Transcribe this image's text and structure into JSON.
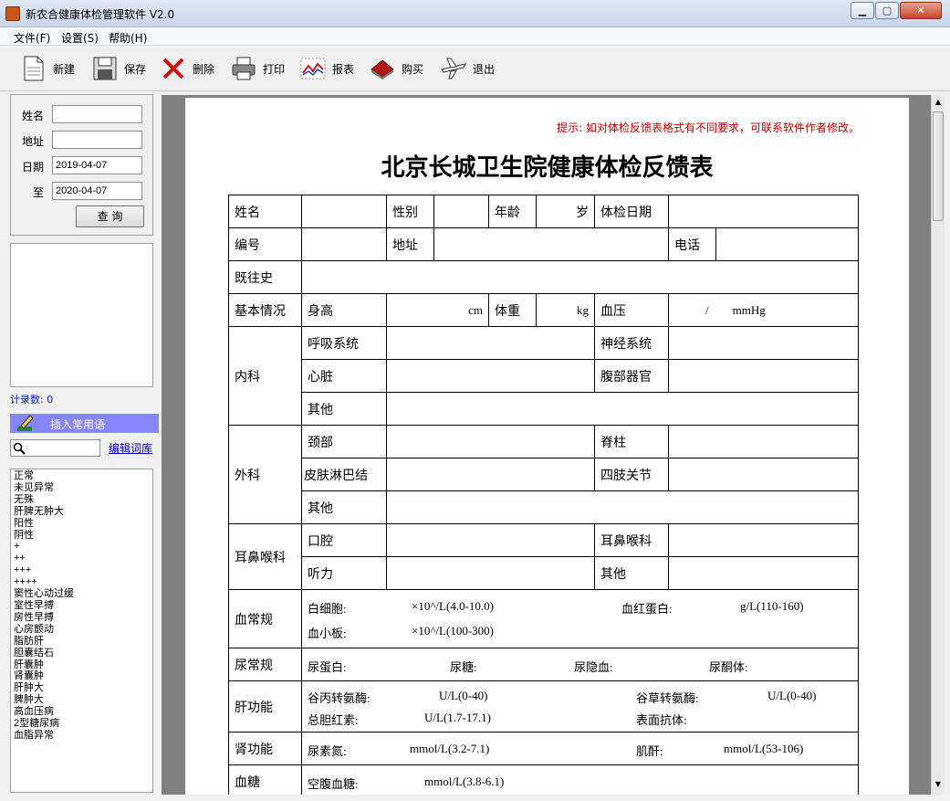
{
  "window": {
    "title": "新农合健康体检管理软件 V2.0"
  },
  "menu": [
    "文件(F)",
    "设置(S)",
    "帮助(H)"
  ],
  "toolbar": {
    "new": "新建",
    "save": "保存",
    "delete": "删除",
    "print": "打印",
    "report": "报表",
    "buy": "购买",
    "exit": "退出"
  },
  "search": {
    "name_label": "姓名",
    "address_label": "地址",
    "date_label": "日期",
    "to_label": "至",
    "date_from": "2019-04-07",
    "date_to": "2020-04-07",
    "query_button": "查 询"
  },
  "records": {
    "count_label": "计录数: 0"
  },
  "phrases": {
    "insert_label": "插入常用语",
    "edit_link": "编辑词库",
    "items": [
      "正常",
      "未见异常",
      "无殊",
      "肝脾无肿大",
      "阳性",
      "阴性",
      "+",
      "++",
      "+++",
      "++++",
      "窦性心动过缓",
      "室性早搏",
      "房性早搏",
      "心房颤动",
      "脂肪肝",
      "胆囊结石",
      "肝囊肿",
      "肾囊肿",
      "肝肿大",
      "脾肿大",
      "高血压病",
      "2型糖尿病",
      "血脂异常"
    ]
  },
  "document": {
    "hint": "提示: 如对体检反馈表格式有不同要求，可联系软件作者修改。",
    "title": "北京长城卫生院健康体检反馈表",
    "rows": {
      "name": "姓名",
      "gender": "性别",
      "age": "年龄",
      "age_unit": "岁",
      "exam_date": "体检日期",
      "id": "编号",
      "address": "地址",
      "phone": "电话",
      "history": "既往史",
      "basic": "基本情况",
      "height": "身高",
      "height_unit": "cm",
      "weight": "体重",
      "weight_unit": "kg",
      "bp": "血压",
      "bp_unit": "/        mmHg",
      "internal": "内科",
      "respiratory": "呼吸系统",
      "nervous": "神经系统",
      "heart": "心脏",
      "abdomen": "腹部器官",
      "other": "其他",
      "surgery": "外科",
      "neck": "颈部",
      "spine": "脊柱",
      "skin_lymph": "皮肤淋巴结",
      "limbs": "四肢关节",
      "ent": "耳鼻喉科",
      "mouth": "口腔",
      "ent2": "耳鼻喉科",
      "hearing": "听力",
      "blood": "血常规",
      "wbc": "白细胞:",
      "wbc_unit": "×10^/L(4.0-10.0)",
      "hgb": "血红蛋白:",
      "hgb_unit": "g/L(110-160)",
      "plt": "血小板:",
      "plt_unit": "×10^/L(100-300)",
      "urine": "尿常规",
      "u_protein": "尿蛋白:",
      "u_sugar": "尿糖:",
      "u_blood": "尿隐血:",
      "u_ketone": "尿酮体:",
      "liver": "肝功能",
      "alt": "谷丙转氨酶:",
      "alt_unit": "U/L(0-40)",
      "ast": "谷草转氨酶:",
      "ast_unit": "U/L(0-40)",
      "tbil": "总胆红素:",
      "tbil_unit": "U/L(1.7-17.1)",
      "hbsag": "表面抗体:",
      "kidney": "肾功能",
      "bun": "尿素氮:",
      "bun_unit": "mmol/L(3.2-7.1)",
      "cr": "肌酐:",
      "cr_unit": "mmol/L(53-106)",
      "glucose": "血糖",
      "fpg": "空腹血糖:",
      "fpg_unit": "mmol/L(3.8-6.1)"
    }
  }
}
